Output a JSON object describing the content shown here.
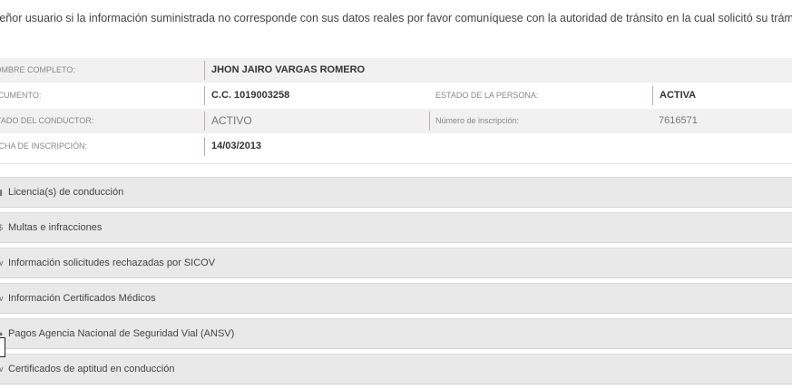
{
  "notice": "Señor usuario si la información suministrada no corresponde con sus datos reales por favor comuníquese con la autoridad de tránsito en la cual solicitó su trámite.",
  "person": {
    "name_label": "NOMBRE COMPLETO:",
    "name_value": "JHON JAIRO VARGAS ROMERO",
    "doc_label": "DOCUMENTO:",
    "doc_value": "C.C. 1019003258",
    "estado_persona_label": "ESTADO DE LA PERSONA:",
    "estado_persona_value": "ACTIVA",
    "estado_conductor_label": "ESTADO DEL CONDUCTOR:",
    "estado_conductor_value": "ACTIVO",
    "inscripcion_num_label": "Número de inscripción:",
    "inscripcion_num_value": "7616571",
    "fecha_label": "FECHA DE INSCRIPCIÓN:",
    "fecha_value": "14/03/2013"
  },
  "sections": [
    {
      "label": "Licencia(s) de conducción",
      "icon": "license-icon"
    },
    {
      "label": "Multas e infracciones",
      "icon": "fines-icon"
    },
    {
      "label": "Información solicitudes rechazadas por SICOV",
      "icon": "chevron-icon"
    },
    {
      "label": "Información Certificados Médicos",
      "icon": "chevron-icon"
    },
    {
      "label": "Pagos Agencia Nacional de Seguridad Vial (ANSV)",
      "icon": "payment-icon"
    },
    {
      "label": "Certificados de aptitud en conducción",
      "icon": "chevron-icon"
    }
  ]
}
